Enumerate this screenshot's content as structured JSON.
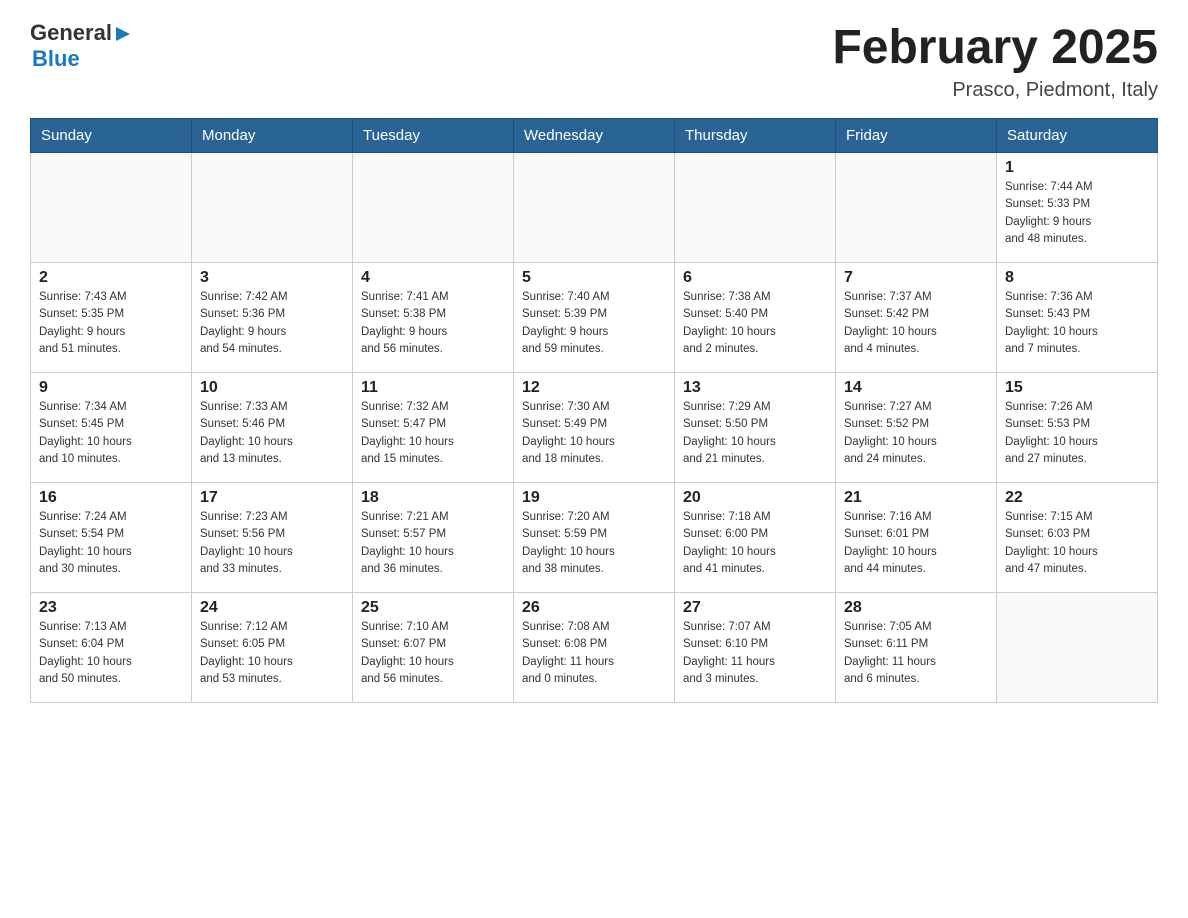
{
  "header": {
    "logo": {
      "general": "General",
      "arrow": "▶",
      "blue": "Blue"
    },
    "title": "February 2025",
    "subtitle": "Prasco, Piedmont, Italy"
  },
  "weekdays": [
    "Sunday",
    "Monday",
    "Tuesday",
    "Wednesday",
    "Thursday",
    "Friday",
    "Saturday"
  ],
  "weeks": [
    [
      {
        "day": "",
        "info": ""
      },
      {
        "day": "",
        "info": ""
      },
      {
        "day": "",
        "info": ""
      },
      {
        "day": "",
        "info": ""
      },
      {
        "day": "",
        "info": ""
      },
      {
        "day": "",
        "info": ""
      },
      {
        "day": "1",
        "info": "Sunrise: 7:44 AM\nSunset: 5:33 PM\nDaylight: 9 hours\nand 48 minutes."
      }
    ],
    [
      {
        "day": "2",
        "info": "Sunrise: 7:43 AM\nSunset: 5:35 PM\nDaylight: 9 hours\nand 51 minutes."
      },
      {
        "day": "3",
        "info": "Sunrise: 7:42 AM\nSunset: 5:36 PM\nDaylight: 9 hours\nand 54 minutes."
      },
      {
        "day": "4",
        "info": "Sunrise: 7:41 AM\nSunset: 5:38 PM\nDaylight: 9 hours\nand 56 minutes."
      },
      {
        "day": "5",
        "info": "Sunrise: 7:40 AM\nSunset: 5:39 PM\nDaylight: 9 hours\nand 59 minutes."
      },
      {
        "day": "6",
        "info": "Sunrise: 7:38 AM\nSunset: 5:40 PM\nDaylight: 10 hours\nand 2 minutes."
      },
      {
        "day": "7",
        "info": "Sunrise: 7:37 AM\nSunset: 5:42 PM\nDaylight: 10 hours\nand 4 minutes."
      },
      {
        "day": "8",
        "info": "Sunrise: 7:36 AM\nSunset: 5:43 PM\nDaylight: 10 hours\nand 7 minutes."
      }
    ],
    [
      {
        "day": "9",
        "info": "Sunrise: 7:34 AM\nSunset: 5:45 PM\nDaylight: 10 hours\nand 10 minutes."
      },
      {
        "day": "10",
        "info": "Sunrise: 7:33 AM\nSunset: 5:46 PM\nDaylight: 10 hours\nand 13 minutes."
      },
      {
        "day": "11",
        "info": "Sunrise: 7:32 AM\nSunset: 5:47 PM\nDaylight: 10 hours\nand 15 minutes."
      },
      {
        "day": "12",
        "info": "Sunrise: 7:30 AM\nSunset: 5:49 PM\nDaylight: 10 hours\nand 18 minutes."
      },
      {
        "day": "13",
        "info": "Sunrise: 7:29 AM\nSunset: 5:50 PM\nDaylight: 10 hours\nand 21 minutes."
      },
      {
        "day": "14",
        "info": "Sunrise: 7:27 AM\nSunset: 5:52 PM\nDaylight: 10 hours\nand 24 minutes."
      },
      {
        "day": "15",
        "info": "Sunrise: 7:26 AM\nSunset: 5:53 PM\nDaylight: 10 hours\nand 27 minutes."
      }
    ],
    [
      {
        "day": "16",
        "info": "Sunrise: 7:24 AM\nSunset: 5:54 PM\nDaylight: 10 hours\nand 30 minutes."
      },
      {
        "day": "17",
        "info": "Sunrise: 7:23 AM\nSunset: 5:56 PM\nDaylight: 10 hours\nand 33 minutes."
      },
      {
        "day": "18",
        "info": "Sunrise: 7:21 AM\nSunset: 5:57 PM\nDaylight: 10 hours\nand 36 minutes."
      },
      {
        "day": "19",
        "info": "Sunrise: 7:20 AM\nSunset: 5:59 PM\nDaylight: 10 hours\nand 38 minutes."
      },
      {
        "day": "20",
        "info": "Sunrise: 7:18 AM\nSunset: 6:00 PM\nDaylight: 10 hours\nand 41 minutes."
      },
      {
        "day": "21",
        "info": "Sunrise: 7:16 AM\nSunset: 6:01 PM\nDaylight: 10 hours\nand 44 minutes."
      },
      {
        "day": "22",
        "info": "Sunrise: 7:15 AM\nSunset: 6:03 PM\nDaylight: 10 hours\nand 47 minutes."
      }
    ],
    [
      {
        "day": "23",
        "info": "Sunrise: 7:13 AM\nSunset: 6:04 PM\nDaylight: 10 hours\nand 50 minutes."
      },
      {
        "day": "24",
        "info": "Sunrise: 7:12 AM\nSunset: 6:05 PM\nDaylight: 10 hours\nand 53 minutes."
      },
      {
        "day": "25",
        "info": "Sunrise: 7:10 AM\nSunset: 6:07 PM\nDaylight: 10 hours\nand 56 minutes."
      },
      {
        "day": "26",
        "info": "Sunrise: 7:08 AM\nSunset: 6:08 PM\nDaylight: 11 hours\nand 0 minutes."
      },
      {
        "day": "27",
        "info": "Sunrise: 7:07 AM\nSunset: 6:10 PM\nDaylight: 11 hours\nand 3 minutes."
      },
      {
        "day": "28",
        "info": "Sunrise: 7:05 AM\nSunset: 6:11 PM\nDaylight: 11 hours\nand 6 minutes."
      },
      {
        "day": "",
        "info": ""
      }
    ]
  ]
}
